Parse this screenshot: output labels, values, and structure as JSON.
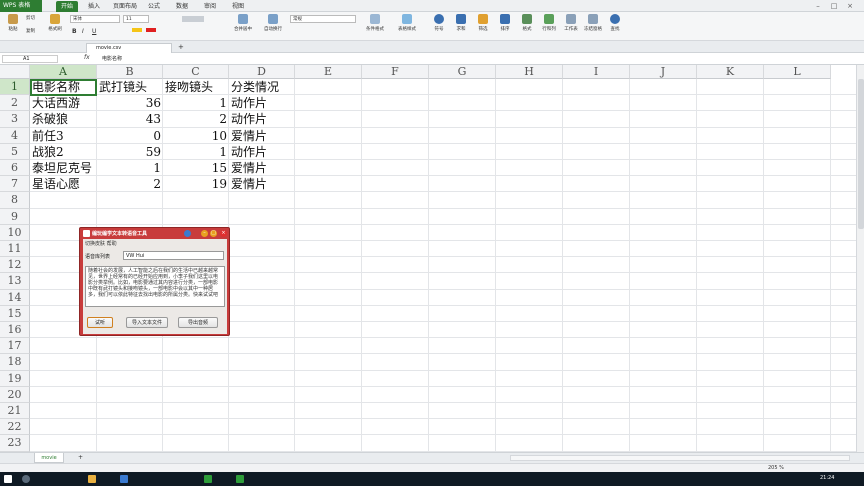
{
  "app": {
    "logo": "WPS 表格",
    "menu_tabs": [
      "开始",
      "插入",
      "页面布局",
      "公式",
      "数据",
      "审阅",
      "视图"
    ]
  },
  "ribbon": {
    "paste": "粘贴",
    "cut": "剪切",
    "copy": "复制",
    "format_painter": "格式刷",
    "font": "宋体",
    "size": "11",
    "bold": "B",
    "italic": "I",
    "underline": "U",
    "merge": "合并居中",
    "wrap": "自动换行",
    "num_format": "常规",
    "cond_format": "条件格式",
    "table_style": "表格样式",
    "symbol": "符号",
    "sum": "求和",
    "filter": "筛选",
    "sort": "排序",
    "format": "格式",
    "rowcol": "行和列",
    "worksheet": "工作表",
    "freeze": "冻结窗格",
    "find": "查找"
  },
  "doc": {
    "file_tab": "movie.csv"
  },
  "formula_bar": {
    "cell": "A1",
    "fx": "fx",
    "content": "电影名称"
  },
  "columns": [
    "A",
    "B",
    "C",
    "D",
    "E",
    "F",
    "G",
    "H",
    "I",
    "J",
    "K",
    "L"
  ],
  "rows": [
    "1",
    "2",
    "3",
    "4",
    "5",
    "6",
    "7",
    "8",
    "9",
    "10",
    "11",
    "12",
    "13",
    "14",
    "15",
    "16",
    "17",
    "18",
    "19",
    "20",
    "21",
    "22",
    "23"
  ],
  "table": {
    "header": [
      "电影名称",
      "武打镜头",
      "接吻镜头",
      "分类情况"
    ],
    "data": [
      [
        "大话西游",
        "36",
        "1",
        "动作片"
      ],
      [
        "杀破狼",
        "43",
        "2",
        "动作片"
      ],
      [
        "前任3",
        "0",
        "10",
        "爱情片"
      ],
      [
        "战狼2",
        "59",
        "1",
        "动作片"
      ],
      [
        "泰坦尼克号",
        "1",
        "15",
        "爱情片"
      ],
      [
        "星语心愿",
        "2",
        "19",
        "爱情片"
      ]
    ]
  },
  "dialog": {
    "title": "编玩编学文本转语音工具",
    "menu": "切换皮肤   帮助",
    "voice_label": "语音库列表",
    "voice_value": "VW Hui",
    "text": "随着社会的发展，人工智能之后在我们的生活中已越来越常见，世界上经常有的已经开始应用到，小李子我们这里以电影分类举例。比如，电影要通过其内容进行分类，一部电影中既有武打镜头和接吻镜头，一部电影中会以其中一种居多，我们可以依此特征去找出电影的所属分类。快来试试吧",
    "btn_listen": "试听",
    "btn_import": "导入文本文件",
    "btn_export": "导出音频"
  },
  "sheet": {
    "tab": "movie"
  },
  "status": {
    "zoom": "205 %"
  },
  "taskbar": {
    "time": "21:24"
  }
}
